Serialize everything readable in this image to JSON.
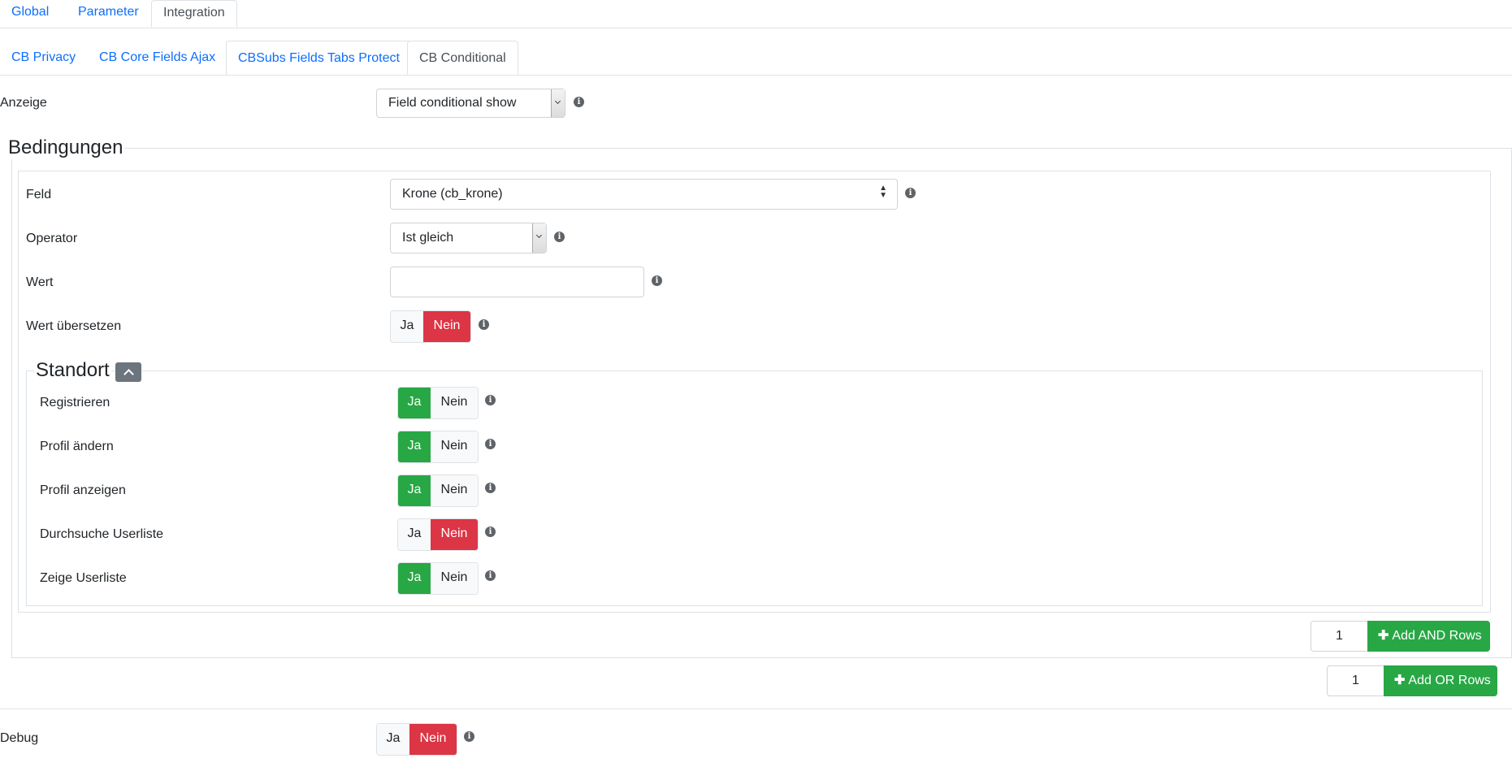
{
  "top_tabs": [
    {
      "label": "Global"
    },
    {
      "label": "Parameter"
    },
    {
      "label": "Integration"
    }
  ],
  "sub_tabs": [
    {
      "label": "CB Privacy"
    },
    {
      "label": "CB Core Fields Ajax"
    },
    {
      "label": "CBSubs Fields Tabs Protect"
    },
    {
      "label": "CB Conditional"
    }
  ],
  "anzeige": {
    "label": "Anzeige",
    "value": "Field conditional show"
  },
  "conditions": {
    "legend": "Bedingungen",
    "feld": {
      "label": "Feld",
      "value": "Krone (cb_krone)"
    },
    "operator": {
      "label": "Operator",
      "value": "Ist gleich"
    },
    "wert": {
      "label": "Wert",
      "value": ""
    },
    "wert_uebersetzen": {
      "label": "Wert übersetzen",
      "yes": "Ja",
      "no": "Nein",
      "selected": "no"
    },
    "standort": {
      "legend": "Standort",
      "rows": [
        {
          "label": "Registrieren",
          "yes": "Ja",
          "no": "Nein",
          "selected": "yes"
        },
        {
          "label": "Profil ändern",
          "yes": "Ja",
          "no": "Nein",
          "selected": "yes"
        },
        {
          "label": "Profil anzeigen",
          "yes": "Ja",
          "no": "Nein",
          "selected": "yes"
        },
        {
          "label": "Durchsuche Userliste",
          "yes": "Ja",
          "no": "Nein",
          "selected": "no"
        },
        {
          "label": "Zeige Userliste",
          "yes": "Ja",
          "no": "Nein",
          "selected": "yes"
        }
      ]
    },
    "and_rows": {
      "count": "1",
      "button": "Add AND Rows"
    },
    "or_rows": {
      "count": "1",
      "button": "Add OR Rows"
    }
  },
  "debug": {
    "label": "Debug",
    "yes": "Ja",
    "no": "Nein",
    "selected": "no"
  },
  "colors": {
    "link": "#0d6efd",
    "yes_active": "#28a745",
    "no_active": "#dc3545",
    "collapse": "#6c757d"
  }
}
